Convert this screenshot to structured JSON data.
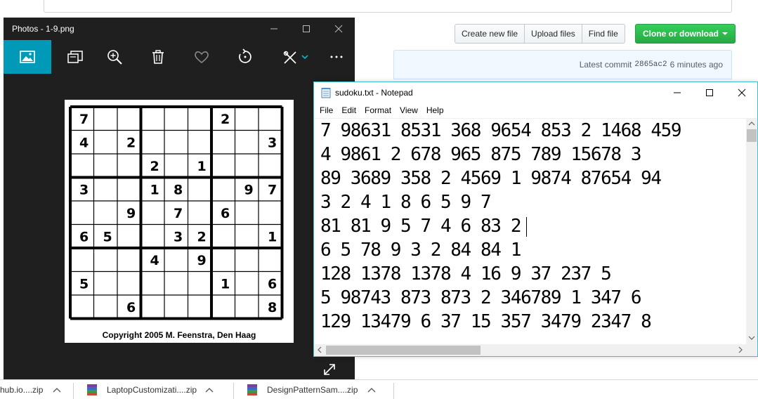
{
  "github": {
    "buttons": [
      "Create new file",
      "Upload files",
      "Find file"
    ],
    "clone_label": "Clone or download",
    "latest_commit_label": "Latest commit",
    "commit_sha": "2865ac2",
    "commit_time": "6 minutes ago",
    "colors": {
      "clone_green": "#28a745",
      "commit_bar": "#f1f8ff"
    }
  },
  "photos": {
    "title": "Photos - 1-9.png",
    "toolbar_icons": [
      "image-icon",
      "slideshow-icon",
      "zoom-icon",
      "delete-icon",
      "favorite-icon",
      "rotate-icon",
      "edit-icon",
      "more-icon"
    ],
    "active_color": "#009ab8",
    "sudoku": {
      "grid": [
        [
          "7",
          "",
          "",
          "",
          "",
          "",
          "2",
          "",
          ""
        ],
        [
          "4",
          "",
          "2",
          "",
          "",
          "",
          "",
          "",
          "3"
        ],
        [
          "",
          "",
          "",
          "2",
          "",
          "1",
          "",
          "",
          ""
        ],
        [
          "3",
          "",
          "",
          "1",
          "8",
          "",
          "",
          "9",
          "7"
        ],
        [
          "",
          "",
          "9",
          "",
          "7",
          "",
          "6",
          "",
          ""
        ],
        [
          "6",
          "5",
          "",
          "",
          "3",
          "2",
          "",
          "",
          "1"
        ],
        [
          "",
          "",
          "",
          "4",
          "",
          "9",
          "",
          "",
          ""
        ],
        [
          "5",
          "",
          "",
          "",
          "",
          "",
          "1",
          "",
          "6"
        ],
        [
          "",
          "",
          "6",
          "",
          "",
          "",
          "",
          "",
          "8"
        ]
      ],
      "copyright": "Copyright 2005 M. Feenstra, Den Haag"
    }
  },
  "notepad": {
    "title": "sudoku.txt - Notepad",
    "menus": [
      "File",
      "Edit",
      "Format",
      "View",
      "Help"
    ],
    "lines": [
      "7 98631 8531 368 9654 853 2 1468 459",
      "4 9861 2 678 965 875 789 15678 3",
      "89 3689 358 2 4569 1 9874 87654 94",
      "3 2 4 1 8 6 5 9 7",
      "81 81 9 5 7 4 6 83 2",
      "6 5 78 9 3 2 84 84 1",
      "128 1378 1378 4 16 9 37 237 5",
      "5 98743 873 873 2 346789 1 347 6",
      "129 13479 6 37 15 357 3479 2347 8"
    ]
  },
  "downloads": [
    {
      "name": "hub.io....zip"
    },
    {
      "name": "LaptopCustomizati....zip"
    },
    {
      "name": "DesignPatternSam....zip"
    }
  ]
}
